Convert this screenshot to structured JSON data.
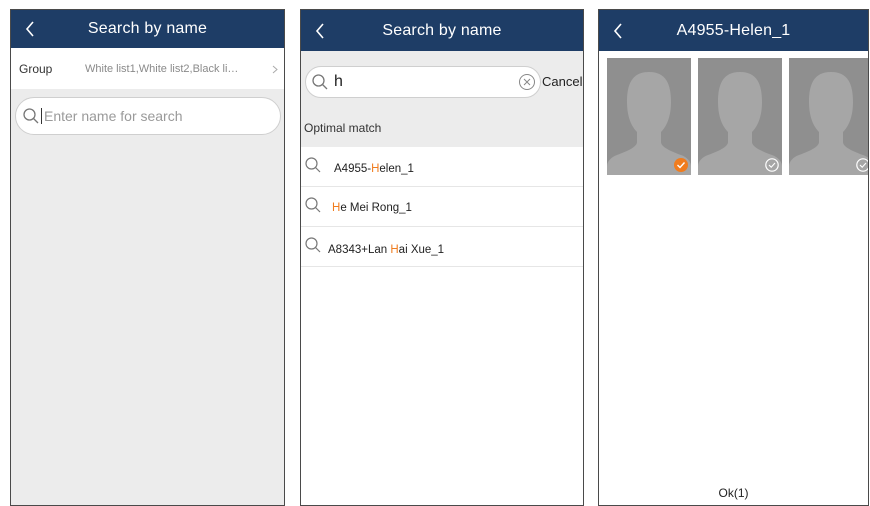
{
  "screen1": {
    "title": "Search by name",
    "group_label": "Group",
    "group_value": "White list1,White list2,Black li…",
    "search_placeholder": "Enter name for search"
  },
  "screen2": {
    "title": "Search by name",
    "query": "h",
    "cancel_label": "Cancel",
    "section_label": "Optimal match",
    "results": [
      {
        "pre": "A4955-",
        "hl": "H",
        "post": "elen_1"
      },
      {
        "pre": "",
        "hl": "H",
        "post": "e Mei  Rong_1"
      },
      {
        "pre": "A8343+Lan ",
        "hl": "H",
        "post": "ai  Xue_1"
      }
    ]
  },
  "screen3": {
    "title": "A4955-Helen_1",
    "photos": [
      {
        "selected": true
      },
      {
        "selected": false
      },
      {
        "selected": false
      }
    ],
    "ok_label": "Ok(1)"
  },
  "colors": {
    "nav_bg": "#1e3d66",
    "highlight": "#f07c1e",
    "list_bg": "#ececec",
    "photo_bg": "#8f8f8f"
  },
  "icons": {
    "back": "chevron-left-icon",
    "search": "search-icon",
    "clear": "clear-icon",
    "selected": "checked-icon",
    "unselected": "check-circle-icon",
    "face": "face-placeholder-icon",
    "more": "chevron-right-icon"
  }
}
